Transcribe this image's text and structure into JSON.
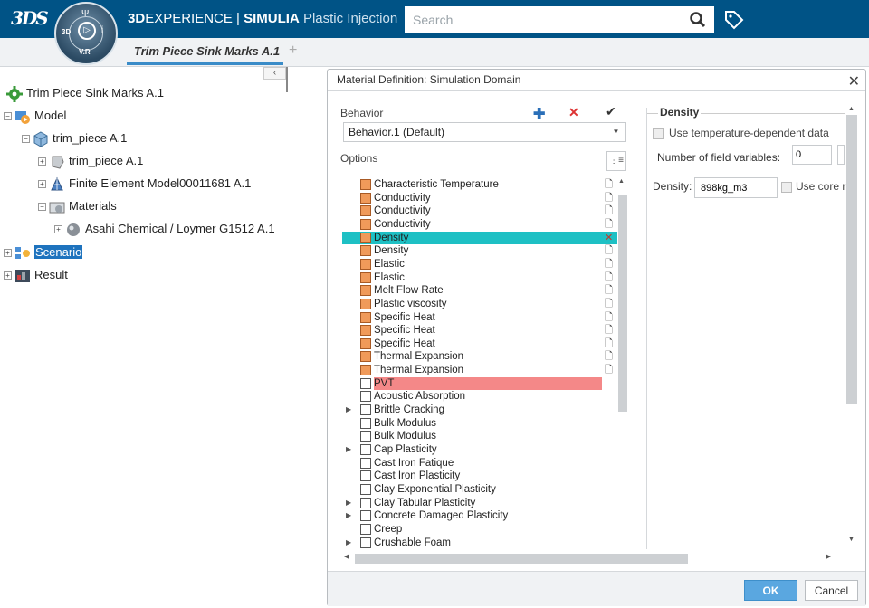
{
  "header": {
    "brand_bold": "3D",
    "brand_main": "EXPERIENCE",
    "brand_sep": " | ",
    "brand_product": "SIMULIA",
    "brand_app": " Plastic Injection",
    "compass": {
      "top": "Ψ",
      "left": "3D",
      "right": "i",
      "bottom": "V.R"
    },
    "search_placeholder": "Search",
    "accent": "#005386"
  },
  "tabs": {
    "active": "Trim Piece Sink Marks A.1",
    "add": "+"
  },
  "tree": {
    "collapse": "‹",
    "nodes": [
      {
        "label": "Trim Piece Sink Marks A.1",
        "icon": "gear-icon"
      },
      {
        "label": "Model",
        "icon": "model-icon"
      },
      {
        "label": "trim_piece A.1",
        "icon": "product-icon"
      },
      {
        "label": "trim_piece A.1",
        "icon": "part-icon"
      },
      {
        "label": "Finite Element Model00011681 A.1",
        "icon": "fem-icon"
      },
      {
        "label": "Materials",
        "icon": "materials-folder-icon"
      },
      {
        "label": "Asahi Chemical / Loymer G1512 A.1",
        "icon": "material-sphere-icon"
      },
      {
        "label": "Scenario",
        "icon": "scenario-icon"
      },
      {
        "label": "Result",
        "icon": "result-icon"
      }
    ]
  },
  "dialog": {
    "title": "Material Definition: Simulation Domain",
    "behavior_label": "Behavior",
    "behavior_value": "Behavior.1 (Default)",
    "options_label": "Options",
    "properties": [
      {
        "label": "Characteristic Temperature",
        "checked": true
      },
      {
        "label": "Conductivity",
        "checked": true
      },
      {
        "label": "Conductivity",
        "checked": true
      },
      {
        "label": "Conductivity",
        "checked": true
      },
      {
        "label": "Density",
        "checked": true,
        "highlight": "cyan"
      },
      {
        "label": "Density",
        "checked": true
      },
      {
        "label": "Elastic",
        "checked": true
      },
      {
        "label": "Elastic",
        "checked": true
      },
      {
        "label": "Melt Flow Rate",
        "checked": true
      },
      {
        "label": "Plastic viscosity",
        "checked": true
      },
      {
        "label": "Specific Heat",
        "checked": true
      },
      {
        "label": "Specific Heat",
        "checked": true
      },
      {
        "label": "Specific Heat",
        "checked": true
      },
      {
        "label": "Thermal Expansion",
        "checked": true
      },
      {
        "label": "Thermal Expansion",
        "checked": true
      },
      {
        "label": "PVT",
        "checked": false,
        "highlight": "red"
      },
      {
        "label": "Acoustic Absorption",
        "checked": false
      },
      {
        "label": "Brittle Cracking",
        "checked": false,
        "expandable": true
      },
      {
        "label": "Bulk Modulus",
        "checked": false
      },
      {
        "label": "Bulk Modulus",
        "checked": false
      },
      {
        "label": "Cap Plasticity",
        "checked": false,
        "expandable": true
      },
      {
        "label": "Cast Iron Fatique",
        "checked": false
      },
      {
        "label": "Cast Iron Plasticity",
        "checked": false
      },
      {
        "label": "Clay Exponential Plasticity",
        "checked": false
      },
      {
        "label": "Clay Tabular Plasticity",
        "checked": false,
        "expandable": true
      },
      {
        "label": "Concrete Damaged Plasticity",
        "checked": false,
        "expandable": true
      },
      {
        "label": "Creep",
        "checked": false
      },
      {
        "label": "Crushable Foam",
        "checked": false,
        "expandable": true
      }
    ],
    "density": {
      "title": "Density",
      "use_temp_label": "Use temperature-dependent data",
      "nfv_label": "Number of field variables:",
      "nfv_value": "0",
      "density_label": "Density:",
      "density_value": "898kg_m3",
      "use_core_label": "Use core r"
    },
    "ok_label": "OK",
    "cancel_label": "Cancel"
  }
}
